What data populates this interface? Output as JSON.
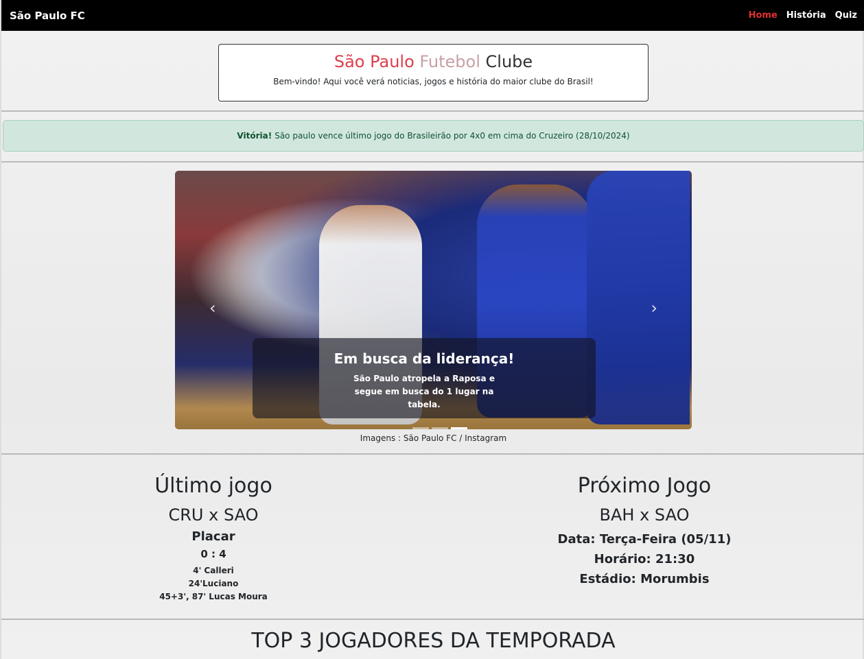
{
  "navbar": {
    "brand": "São Paulo FC",
    "links": [
      {
        "label": "Home",
        "active": true
      },
      {
        "label": "História",
        "active": false
      },
      {
        "label": "Quiz",
        "active": false
      }
    ],
    "active_color": "#e03131"
  },
  "header": {
    "title_parts": [
      "São",
      "Paulo",
      "Futebol",
      "Clube"
    ],
    "subtitle": "Bem-vindo! Aqui você verá noticias, jogos e história do maior clube do Brasil!"
  },
  "alert": {
    "strong": "Vitória!",
    "text": "São paulo vence último jogo do Brasileirão por 4x0 em cima do Cruzeiro (28/10/2024)"
  },
  "carousel": {
    "prev_icon": "chevron-left-icon",
    "next_icon": "chevron-right-icon",
    "caption_title": "Em busca da liderança!",
    "caption_text": "São Paulo atropela a Raposa e segue em busca do 1 lugar na tabela.",
    "credit": "Imagens : São Paulo FC / Instagram"
  },
  "last_game": {
    "heading": "Último jogo",
    "match": "CRU x SAO",
    "score_label": "Placar",
    "score": "0 : 4",
    "goals": [
      "4' Calleri",
      "24'Luciano",
      "45+3', 87' Lucas Moura"
    ]
  },
  "next_game": {
    "heading": "Próximo Jogo",
    "match": "BAH x SAO",
    "date": "Data: Terça-Feira (05/11)",
    "time": "Horário: 21:30",
    "stadium": "Estádio: Morumbis"
  },
  "top3": {
    "heading": "TOP 3 JOGADORES DA TEMPORADA"
  }
}
